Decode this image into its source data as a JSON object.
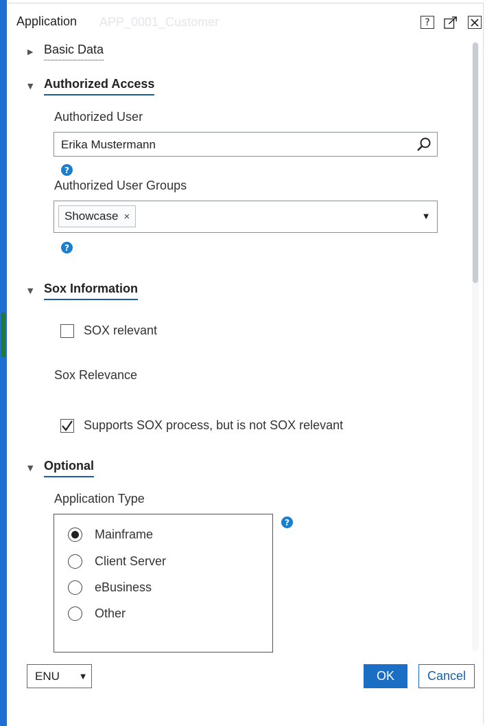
{
  "dialog": {
    "title": "Application",
    "faded_title": "APP_0001_Customer",
    "help_btn": "?",
    "popout_btn": "↗",
    "close_btn": "✕"
  },
  "sections": {
    "basic_data": "Basic Data",
    "authorized_access": "Authorized Access",
    "sox_information": "Sox Information",
    "optional": "Optional"
  },
  "authorized_access": {
    "user_label": "Authorized User",
    "user_value": "Erika Mustermann",
    "groups_label": "Authorized User Groups",
    "groups_tokens": [
      "Showcase"
    ]
  },
  "sox": {
    "sox_relevant_label": "SOX relevant",
    "sox_relevant_checked": false,
    "relevance_label": "Sox Relevance",
    "supports_label": "Supports SOX process, but is not SOX relevant",
    "supports_checked": true
  },
  "optional": {
    "app_type_label": "Application Type",
    "options": [
      "Mainframe",
      "Client Server",
      "eBusiness",
      "Other"
    ],
    "selected": "Mainframe"
  },
  "footer": {
    "language": "ENU",
    "ok_label": "OK",
    "cancel_label": "Cancel"
  },
  "icons": {
    "help": "?",
    "token_remove": "×",
    "caret": "▼",
    "collapsed": "▶",
    "expanded": "▼",
    "check": "✓"
  },
  "colors": {
    "accent": "#1a6fc4",
    "left_bar": "#1d6fd2",
    "help_icon": "#1a7fd0"
  }
}
